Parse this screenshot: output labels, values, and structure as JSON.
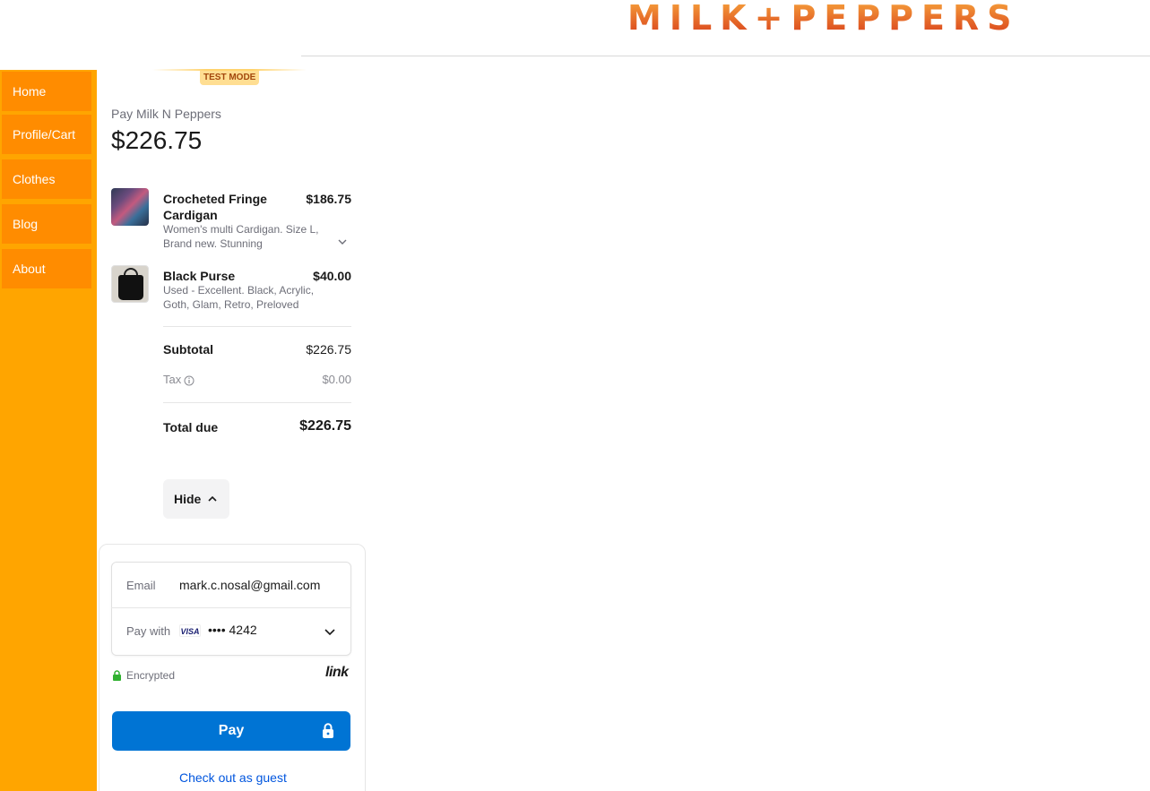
{
  "header": {
    "logo_text": "MILK+PEPPERS"
  },
  "sidebar": {
    "items": [
      {
        "label": "Home"
      },
      {
        "label": "Profile/Cart"
      },
      {
        "label": "Clothes"
      },
      {
        "label": "Blog"
      },
      {
        "label": "About"
      }
    ]
  },
  "checkout": {
    "test_mode": "TEST MODE",
    "pay_to": "Pay Milk N Peppers",
    "amount": "$226.75",
    "items": [
      {
        "name": "Crocheted Fringe Cardigan",
        "price": "$186.75",
        "desc": "Women's multi Cardigan. Size L, Brand new. Stunning handmade..."
      },
      {
        "name": "Black Purse",
        "price": "$40.00",
        "desc": "Used - Excellent. Black, Acrylic, Goth, Glam, Retro, Preloved"
      }
    ],
    "subtotal_label": "Subtotal",
    "subtotal": "$226.75",
    "tax_label": "Tax",
    "tax": "$0.00",
    "total_label": "Total due",
    "total": "$226.75",
    "hide_label": "Hide"
  },
  "payment": {
    "email_label": "Email",
    "email": "mark.c.nosal@gmail.com",
    "pay_with_label": "Pay with",
    "card_brand": "VISA",
    "card_number": "•••• 4242",
    "encrypted": "Encrypted",
    "link_logo": "link",
    "pay_button": "Pay",
    "guest_link": "Check out as guest"
  },
  "colors": {
    "sidebar": "#ffa500",
    "nav_item": "#ff8c00",
    "pay_button": "#0074d4",
    "link": "#0055de"
  }
}
